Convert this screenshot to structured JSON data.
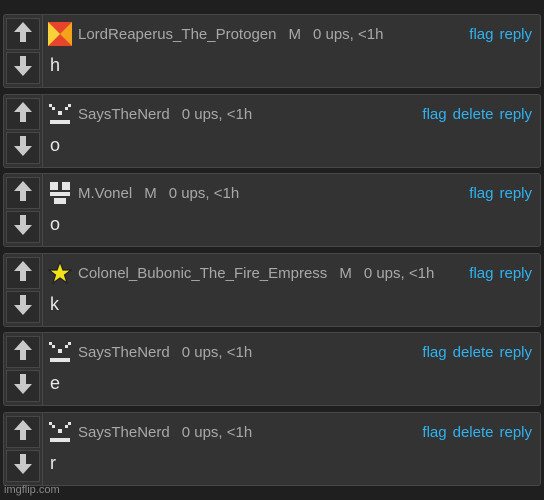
{
  "comments": [
    {
      "username": "LordReaperus_The_Protogen",
      "mod": "M",
      "meta": "0 ups, <1h",
      "text": "h",
      "avatar": "pixel-orange-hourglass",
      "actions": [
        "flag",
        "reply"
      ]
    },
    {
      "username": "SaysTheNerd",
      "mod": "",
      "meta": "0 ups, <1h",
      "text": "o",
      "avatar": "pixel-face",
      "actions": [
        "flag",
        "delete",
        "reply"
      ]
    },
    {
      "username": "M.Vonel",
      "mod": "M",
      "meta": "0 ups, <1h",
      "text": "o",
      "avatar": "pixel-face-2",
      "actions": [
        "flag",
        "reply"
      ]
    },
    {
      "username": "Colonel_Bubonic_The_Fire_Empress",
      "mod": "M",
      "meta": "0 ups, <1h",
      "text": "k",
      "avatar": "yellow-star",
      "actions": [
        "flag",
        "reply"
      ]
    },
    {
      "username": "SaysTheNerd",
      "mod": "",
      "meta": "0 ups, <1h",
      "text": "e",
      "avatar": "pixel-face",
      "actions": [
        "flag",
        "delete",
        "reply"
      ]
    },
    {
      "username": "SaysTheNerd",
      "mod": "",
      "meta": "0 ups, <1h",
      "text": "r",
      "avatar": "pixel-face",
      "actions": [
        "flag",
        "delete",
        "reply"
      ]
    }
  ],
  "watermark": "imgflip.com",
  "colors": {
    "link": "#2fb3f0",
    "background": "#1f1f20",
    "panel": "#333334"
  }
}
